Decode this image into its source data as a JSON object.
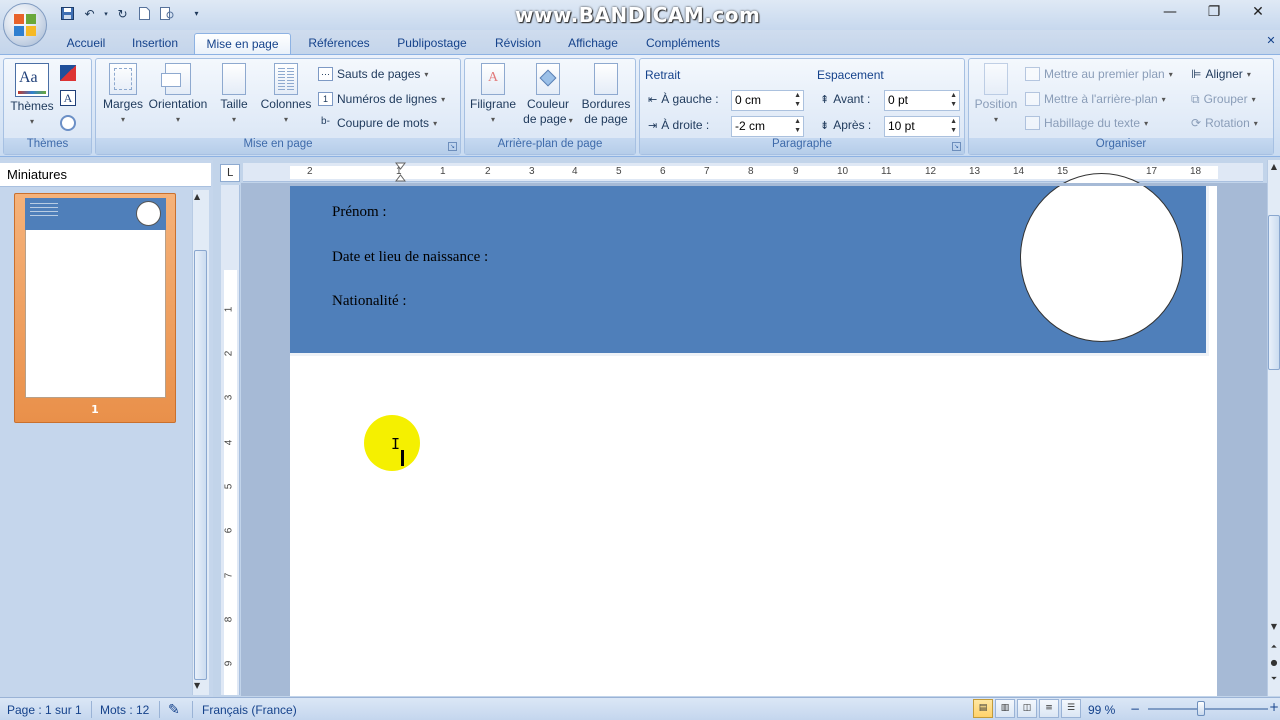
{
  "window": {
    "watermark": "www.BANDICAM.com",
    "controls": {
      "minimize": "—",
      "maximize": "❐",
      "close": "✕"
    }
  },
  "qat": {
    "icons": [
      "save-icon",
      "undo-icon",
      "redo-icon",
      "new-document-icon",
      "print-preview-icon",
      "customize-icon"
    ]
  },
  "tabs": [
    {
      "label": "Accueil",
      "active": false
    },
    {
      "label": "Insertion",
      "active": false
    },
    {
      "label": "Mise en page",
      "active": true
    },
    {
      "label": "Références",
      "active": false
    },
    {
      "label": "Publipostage",
      "active": false
    },
    {
      "label": "Révision",
      "active": false
    },
    {
      "label": "Affichage",
      "active": false
    },
    {
      "label": "Compléments",
      "active": false
    }
  ],
  "ribbon": {
    "themes": {
      "title": "Thèmes",
      "button": "Thèmes"
    },
    "mise_en_page": {
      "title": "Mise en page",
      "marges": "Marges",
      "orientation": "Orientation",
      "taille": "Taille",
      "colonnes": "Colonnes",
      "sauts": "Sauts de pages",
      "numeros": "Numéros de lignes",
      "coupure": "Coupure de mots"
    },
    "arriere_plan": {
      "title": "Arrière-plan de page",
      "filigrane": "Filigrane",
      "couleur_l1": "Couleur",
      "couleur_l2": "de page",
      "bordures_l1": "Bordures",
      "bordures_l2": "de page"
    },
    "paragraphe": {
      "title": "Paragraphe",
      "retrait": "Retrait",
      "gauche_label": "À gauche :",
      "gauche_value": "0 cm",
      "droite_label": "À droite :",
      "droite_value": "-2 cm",
      "espacement": "Espacement",
      "avant_label": "Avant :",
      "avant_value": "0  pt",
      "apres_label": "Après :",
      "apres_value": "10  pt"
    },
    "organiser": {
      "title": "Organiser",
      "position": "Position",
      "premier_plan": "Mettre au premier plan",
      "arriere_plan": "Mettre à l'arrière-plan",
      "habillage": "Habillage du texte",
      "aligner": "Aligner",
      "grouper": "Grouper",
      "rotation": "Rotation"
    }
  },
  "thumbnails": {
    "title": "Miniatures",
    "page_number": "1"
  },
  "ruler": {
    "h_ticks": [
      "2",
      "1",
      "1",
      "2",
      "3",
      "4",
      "5",
      "6",
      "7",
      "8",
      "9",
      "10",
      "11",
      "12",
      "13",
      "14",
      "15",
      "17",
      "18"
    ],
    "v_ticks": [
      "1",
      "2",
      "3",
      "4",
      "5",
      "6",
      "7",
      "8",
      "9"
    ]
  },
  "document": {
    "prenom": "Prénom :",
    "date_lieu": "Date et lieu de naissance :",
    "nationalite": "Nationalité :",
    "header_color": "#4f7fba"
  },
  "status": {
    "page": "Page : 1 sur 1",
    "mots": "Mots : 12",
    "langue": "Français (France)",
    "zoom": "99 %"
  }
}
